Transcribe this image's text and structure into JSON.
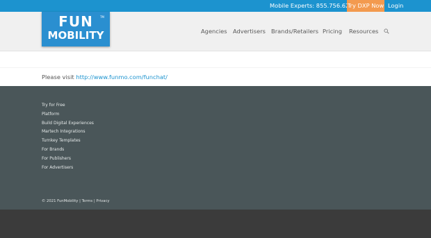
{
  "topbar": {
    "phone_text": "Mobile Experts: 855.756.6245",
    "try_label": "Try DXP Now",
    "login_label": "Login"
  },
  "logo": {
    "line1": "FUN",
    "line2": "MOBILITY",
    "tm": "TM"
  },
  "nav": {
    "items": [
      "Agencies",
      "Advertisers",
      "Brands/Retailers",
      "Pricing",
      "Resources"
    ],
    "search_icon": "search-icon"
  },
  "notice": {
    "prefix": "Please visit",
    "link_text": "http://www.funmo.com/funchat/"
  },
  "footer": {
    "links": [
      "Try for Free",
      "Platform",
      "Build Digital Experiences",
      "Martech Integrations",
      "Turnkey Templates",
      "For Brands",
      "For Publishers",
      "For Advertisers"
    ],
    "copyright": "© 2021 FunMobility",
    "separator": "|",
    "terms": "Terms",
    "privacy": "Privacy"
  },
  "colors": {
    "topbar": "#1c93cf",
    "accent_orange": "#f39a4f",
    "footer": "#4a5659",
    "bottom": "#3b3b3b"
  }
}
